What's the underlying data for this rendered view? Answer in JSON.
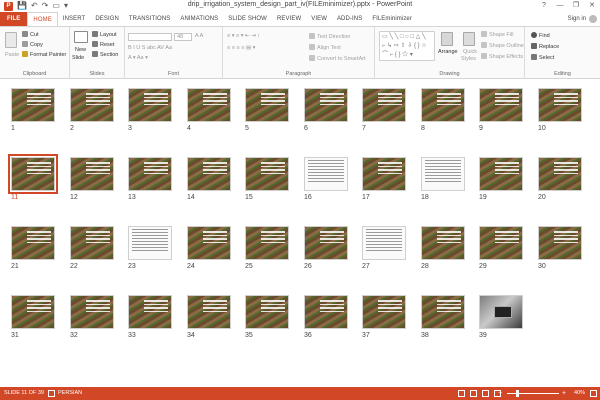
{
  "app": {
    "title": "drip_irrigation_system_design_part_iv(FILEminimizer).pptx - PowerPoint",
    "window_controls": [
      "?",
      "—",
      "❐",
      "✕"
    ]
  },
  "qat": {
    "app_icon": "P",
    "items": [
      {
        "name": "save-icon",
        "glyph": "💾"
      },
      {
        "name": "undo-icon",
        "glyph": "↶"
      },
      {
        "name": "redo-icon",
        "glyph": "↷"
      },
      {
        "name": "slideshow-icon",
        "glyph": "▭"
      },
      {
        "name": "qat-dropdown-icon",
        "glyph": "▾"
      }
    ]
  },
  "tabs": [
    "FILE",
    "HOME",
    "INSERT",
    "DESIGN",
    "TRANSITIONS",
    "ANIMATIONS",
    "SLIDE SHOW",
    "REVIEW",
    "VIEW",
    "ADD-INS",
    "FILEminimizer"
  ],
  "active_tab": "HOME",
  "signin": "Sign in",
  "ribbon": {
    "clipboard": {
      "label": "Clipboard",
      "paste": "Paste",
      "cut": "Cut",
      "copy": "Copy",
      "format_painter": "Format Painter"
    },
    "slides": {
      "label": "Slides",
      "new_slide": "New",
      "new_slide_2": "Slide",
      "layout": "Layout",
      "reset": "Reset",
      "section": "Section"
    },
    "font": {
      "label": "Font",
      "size": "48"
    },
    "paragraph": {
      "label": "Paragraph",
      "text_direction": "Text Direction",
      "align_text": "Align Text",
      "convert_smartart": "Convert to SmartArt"
    },
    "drawing": {
      "label": "Drawing",
      "arrange": "Arrange",
      "quick_styles": "Quick",
      "quick_styles_2": "Styles",
      "shape_fill": "Shape Fill",
      "shape_outline": "Shape Outline",
      "shape_effects": "Shape Effects"
    },
    "editing": {
      "label": "Editing",
      "find": "Find",
      "replace": "Replace",
      "select": "Select"
    }
  },
  "slides": [
    {
      "number": "1",
      "kind": "field"
    },
    {
      "number": "2",
      "kind": "field"
    },
    {
      "number": "3",
      "kind": "field"
    },
    {
      "number": "4",
      "kind": "field"
    },
    {
      "number": "5",
      "kind": "field"
    },
    {
      "number": "6",
      "kind": "field"
    },
    {
      "number": "7",
      "kind": "field"
    },
    {
      "number": "8",
      "kind": "field"
    },
    {
      "number": "9",
      "kind": "field"
    },
    {
      "number": "10",
      "kind": "field"
    },
    {
      "number": "11",
      "kind": "field",
      "selected": true
    },
    {
      "number": "12",
      "kind": "field"
    },
    {
      "number": "13",
      "kind": "field"
    },
    {
      "number": "14",
      "kind": "field"
    },
    {
      "number": "15",
      "kind": "field"
    },
    {
      "number": "16",
      "kind": "diagram"
    },
    {
      "number": "17",
      "kind": "field"
    },
    {
      "number": "18",
      "kind": "diagram"
    },
    {
      "number": "19",
      "kind": "field"
    },
    {
      "number": "20",
      "kind": "field"
    },
    {
      "number": "21",
      "kind": "field"
    },
    {
      "number": "22",
      "kind": "field"
    },
    {
      "number": "23",
      "kind": "diagram"
    },
    {
      "number": "24",
      "kind": "field"
    },
    {
      "number": "25",
      "kind": "field"
    },
    {
      "number": "26",
      "kind": "field"
    },
    {
      "number": "27",
      "kind": "diagram"
    },
    {
      "number": "28",
      "kind": "field"
    },
    {
      "number": "29",
      "kind": "field"
    },
    {
      "number": "30",
      "kind": "field"
    },
    {
      "number": "31",
      "kind": "field"
    },
    {
      "number": "32",
      "kind": "field"
    },
    {
      "number": "33",
      "kind": "field"
    },
    {
      "number": "34",
      "kind": "field"
    },
    {
      "number": "35",
      "kind": "field"
    },
    {
      "number": "36",
      "kind": "field"
    },
    {
      "number": "37",
      "kind": "field"
    },
    {
      "number": "38",
      "kind": "field"
    },
    {
      "number": "39",
      "kind": "photo"
    }
  ],
  "status": {
    "slide_info": "SLIDE 11 OF 39",
    "language": "PERSIAN",
    "zoom_minus": "−",
    "zoom_plus": "+",
    "zoom": "40%"
  },
  "colors": {
    "accent": "#d24726",
    "ribbon_bg": "#fafafa"
  }
}
